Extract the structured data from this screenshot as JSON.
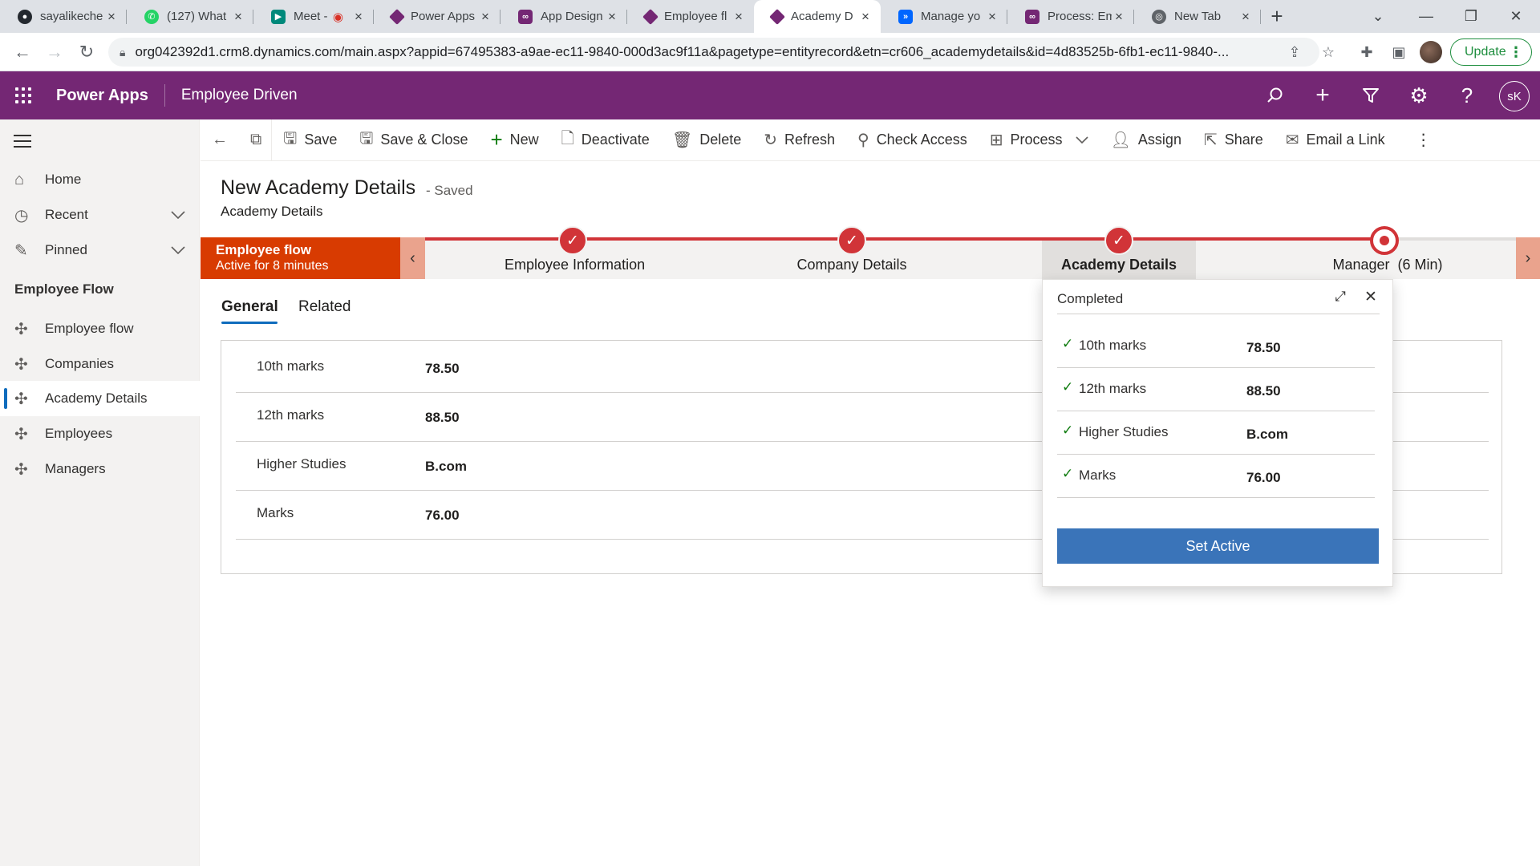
{
  "browser": {
    "tabs": [
      {
        "title": "sayalikeche",
        "icon": "github-icon",
        "color": "#24292f"
      },
      {
        "title": "(127) What",
        "icon": "whatsapp-icon",
        "color": "#25d366"
      },
      {
        "title": "Meet -",
        "icon": "google-meet-icon",
        "color": "#00897b"
      },
      {
        "title": "Power Apps",
        "icon": "power-apps-icon",
        "color": "#742774"
      },
      {
        "title": "App Design",
        "icon": "power-apps-icon",
        "color": "#742774"
      },
      {
        "title": "Employee fl",
        "icon": "power-apps-icon",
        "color": "#742774"
      },
      {
        "title": "Academy D",
        "icon": "power-apps-icon",
        "color": "#742774"
      },
      {
        "title": "Manage yo",
        "icon": "power-automate-icon",
        "color": "#0066ff"
      },
      {
        "title": "Process: Em",
        "icon": "power-apps-icon",
        "color": "#742774"
      },
      {
        "title": "New Tab",
        "icon": "chrome-icon",
        "color": "#5f6368"
      }
    ],
    "active_tab_index": 6,
    "url": "org042392d1.crm8.dynamics.com/main.aspx?appid=67495383-a9ae-ec11-9840-000d3ac9f11a&pagetype=entityrecord&etn=cr606_academydetails&id=4d83525b-6fb1-ec11-9840-...",
    "update_label": "Update"
  },
  "header": {
    "brand": "Power Apps",
    "app_name": "Employee Driven",
    "avatar_initials": "sK",
    "accent_color": "#742774"
  },
  "leftnav": {
    "top_items": [
      {
        "label": "Home",
        "icon": "home-icon"
      },
      {
        "label": "Recent",
        "icon": "clock-icon",
        "expandable": true
      },
      {
        "label": "Pinned",
        "icon": "pin-icon",
        "expandable": true
      }
    ],
    "section_title": "Employee Flow",
    "section_items": [
      {
        "label": "Employee flow",
        "icon": "puzzle-icon"
      },
      {
        "label": "Companies",
        "icon": "puzzle-icon"
      },
      {
        "label": "Academy Details",
        "icon": "puzzle-icon",
        "selected": true
      },
      {
        "label": "Employees",
        "icon": "puzzle-icon"
      },
      {
        "label": "Managers",
        "icon": "puzzle-icon"
      }
    ]
  },
  "commandbar": {
    "save": "Save",
    "save_close": "Save & Close",
    "new": "New",
    "deactivate": "Deactivate",
    "delete": "Delete",
    "refresh": "Refresh",
    "check_access": "Check Access",
    "process": "Process",
    "assign": "Assign",
    "share": "Share",
    "email_link": "Email a Link"
  },
  "form": {
    "title": "New Academy Details",
    "saved_status": "- Saved",
    "entity": "Academy Details"
  },
  "bpf": {
    "flow_name": "Employee flow",
    "active_for": "Active for 8 minutes",
    "stages": [
      {
        "label": "Employee Information",
        "status": "completed"
      },
      {
        "label": "Company Details",
        "status": "completed"
      },
      {
        "label": "Academy Details",
        "status": "completed",
        "selected": true
      },
      {
        "label": "Manager  (6 Min)",
        "status": "active"
      }
    ],
    "flag_color": "#d83b01",
    "progress_color": "#d13438"
  },
  "tabs": {
    "general": "General",
    "related": "Related"
  },
  "fields": [
    {
      "label": "10th marks",
      "value": "78.50"
    },
    {
      "label": "12th marks",
      "value": "88.50"
    },
    {
      "label": "Higher Studies",
      "value": "B.com"
    },
    {
      "label": "Marks",
      "value": "76.00"
    }
  ],
  "flyout": {
    "title": "Completed",
    "fields": [
      {
        "label": "10th marks",
        "value": "78.50"
      },
      {
        "label": "12th marks",
        "value": "88.50"
      },
      {
        "label": "Higher Studies",
        "value": "B.com"
      },
      {
        "label": "Marks",
        "value": "76.00"
      }
    ],
    "button": "Set Active",
    "button_color": "#3a74b9"
  }
}
